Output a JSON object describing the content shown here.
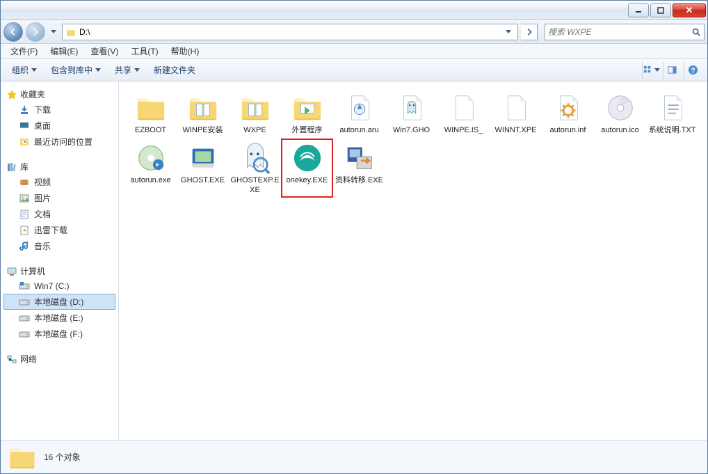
{
  "address": {
    "path": "D:\\"
  },
  "search": {
    "placeholder": "搜索 WXPE"
  },
  "menubar": [
    {
      "label": "文件(F)"
    },
    {
      "label": "编辑(E)"
    },
    {
      "label": "查看(V)"
    },
    {
      "label": "工具(T)"
    },
    {
      "label": "帮助(H)"
    }
  ],
  "toolbar": {
    "organize": "组织",
    "include": "包含到库中",
    "share": "共享",
    "newfolder": "新建文件夹"
  },
  "sidebar": {
    "favorites": {
      "label": "收藏夹",
      "items": [
        {
          "icon": "download",
          "label": "下载"
        },
        {
          "icon": "desktop",
          "label": "桌面"
        },
        {
          "icon": "recent",
          "label": "最近访问的位置"
        }
      ]
    },
    "libraries": {
      "label": "库",
      "items": [
        {
          "icon": "video",
          "label": "视频"
        },
        {
          "icon": "picture",
          "label": "图片"
        },
        {
          "icon": "document",
          "label": "文档"
        },
        {
          "icon": "thunder",
          "label": "迅雷下载"
        },
        {
          "icon": "music",
          "label": "音乐"
        }
      ]
    },
    "computer": {
      "label": "计算机",
      "items": [
        {
          "icon": "drive-win",
          "label": "Win7 (C:)"
        },
        {
          "icon": "drive",
          "label": "本地磁盘 (D:)",
          "selected": true
        },
        {
          "icon": "drive",
          "label": "本地磁盘 (E:)"
        },
        {
          "icon": "drive",
          "label": "本地磁盘 (F:)"
        }
      ]
    },
    "network": {
      "label": "网络"
    }
  },
  "files": [
    {
      "icon": "folder-blue",
      "name": "EZBOOT"
    },
    {
      "icon": "folder-docs",
      "name": "WINPE安装"
    },
    {
      "icon": "folder-docs",
      "name": "WXPE"
    },
    {
      "icon": "folder-exe",
      "name": "外置程序"
    },
    {
      "icon": "aru",
      "name": "autorun.aru"
    },
    {
      "icon": "ghost",
      "name": "Win7.GHO"
    },
    {
      "icon": "blank",
      "name": "WINPE.IS_"
    },
    {
      "icon": "blank",
      "name": "WINNT.XPE"
    },
    {
      "icon": "gear",
      "name": "autorun.inf"
    },
    {
      "icon": "disc",
      "name": "autorun.ico"
    },
    {
      "icon": "txt",
      "name": "系统说明.TXT"
    },
    {
      "icon": "autorun-exe",
      "name": "autorun.exe"
    },
    {
      "icon": "ghost-exe",
      "name": "GHOST.EXE"
    },
    {
      "icon": "ghostexp",
      "name": "GHOSTEXP.EXE"
    },
    {
      "icon": "onekey",
      "name": "onekey.EXE",
      "highlighted": true
    },
    {
      "icon": "migrate",
      "name": "资料转移.EXE"
    }
  ],
  "status": {
    "text": "16 个对象"
  }
}
